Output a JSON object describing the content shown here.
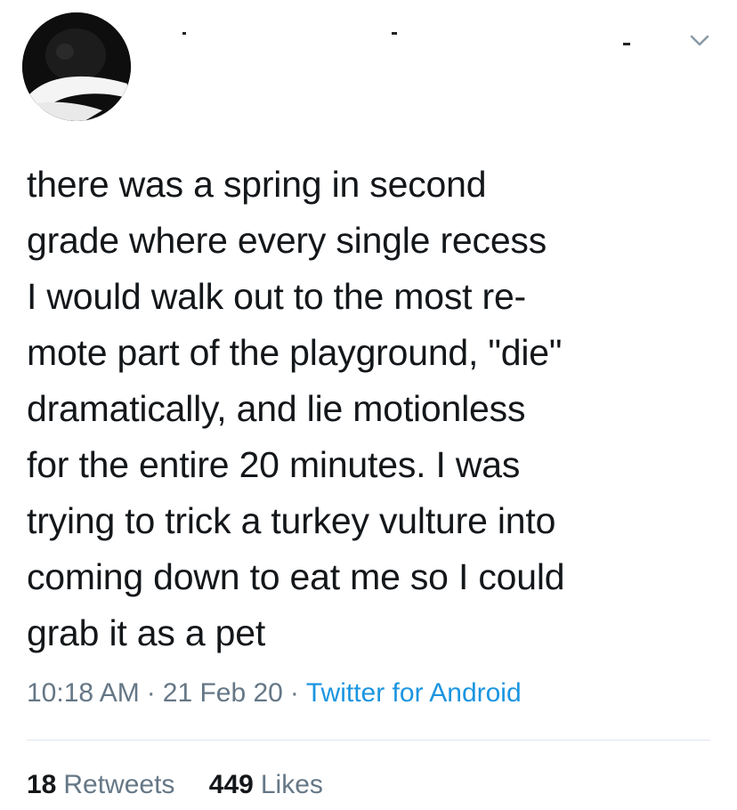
{
  "tweet": {
    "text": "there was a spring in second\ngrade where every single recess\nI would walk out to the most re-\nmote part of the playground, \"die\"\ndramatically, and lie motionless\nfor the entire 20 minutes. I was\ntrying to trick a turkey vulture into\ncoming down to eat me so I could\ngrab it as a pet",
    "time": "10:18 AM",
    "date": "21 Feb 20",
    "source": "Twitter for Android",
    "separator": "·"
  },
  "stats": {
    "retweets_count": "18",
    "retweets_label": "Retweets",
    "likes_count": "449",
    "likes_label": "Likes"
  },
  "icons": {
    "more": "chevron-down-icon",
    "avatar": "avatar"
  },
  "colors": {
    "text": "#14171a",
    "muted": "#657786",
    "link": "#1b95e0",
    "divider": "#e1e8ed"
  }
}
